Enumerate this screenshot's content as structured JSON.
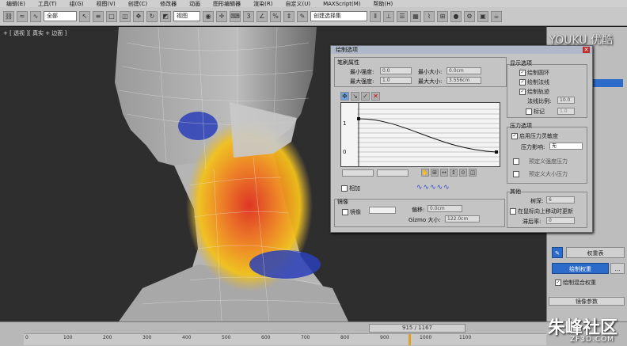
{
  "menu": {
    "items": [
      "编辑(E)",
      "工具(T)",
      "组(G)",
      "视图(V)",
      "创建(C)",
      "修改器",
      "动画",
      "图形编辑器",
      "渲染(R)",
      "自定义(U)",
      "MAXScript(M)",
      "帮助(H)"
    ]
  },
  "toolbar": {
    "filter_select": "全部",
    "view_select": "视图",
    "selection_set": "创建选择集"
  },
  "viewport": {
    "label": "+ [ 透视 ][ 真实 + 边面 ]"
  },
  "dialog": {
    "title": "绘制选项",
    "brush_props": {
      "title": "笔刷属性",
      "min_strength_label": "最小强度:",
      "min_strength_value": "0.0",
      "max_strength_label": "最大强度:",
      "max_strength_value": "1.0",
      "min_size_label": "最小大小:",
      "min_size_value": "0.0cm",
      "max_size_label": "最大大小:",
      "max_size_value": "3.556cm"
    },
    "curve": {
      "y_top": "1",
      "y_bottom": "0"
    },
    "mirror_checkbox": "相加",
    "mirror": {
      "title": "镜像",
      "mirror_label": "镜像",
      "offset_label": "偏移:",
      "offset_value": "0.0cm",
      "gizmo_label": "Gizmo 大小:",
      "gizmo_value": "122.0cm"
    },
    "display": {
      "title": "显示选项",
      "draw_ring": "绘制圆环",
      "draw_normal": "绘制法线",
      "draw_trail": "绘制轨迹",
      "normal_scale_label": "法线比例:",
      "normal_scale_value": "10.0",
      "marker_label": "标记",
      "marker_value": "1.0"
    },
    "pressure": {
      "title": "压力选项",
      "enable_label": "启用压力灵敏度",
      "affect_label": "压力影响:",
      "affect_value": "无",
      "predef_strength": "预定义强度压力",
      "predef_size": "预定义大小压力"
    },
    "other": {
      "title": "其他",
      "depth_label": "树深:",
      "depth_value": "6",
      "update_label": "在鼠标向上移动时更新",
      "lag_label": "滞后率:",
      "lag_value": "0"
    }
  },
  "right_panel": {
    "weight_table": "权重表",
    "paint_weights": "绘制权重",
    "paint_blend": "绘制混合权重",
    "mirror_params": "镜像参数",
    "more": "..."
  },
  "timeline": {
    "frame_counter": "915 / 1167",
    "ruler_ticks": [
      "0",
      "100",
      "200",
      "300",
      "400",
      "500",
      "600",
      "700",
      "800",
      "900",
      "1000",
      "1100"
    ]
  },
  "watermark": {
    "youku": "YOUKU 优酷",
    "site": "朱峰社区",
    "site_sub": "ZF3D.COM"
  },
  "colors": {
    "accent": "#2c6bc9",
    "heat_red": "#e0301e",
    "heat_yellow": "#f2c21b",
    "heat_blue": "#2a3fb8"
  }
}
